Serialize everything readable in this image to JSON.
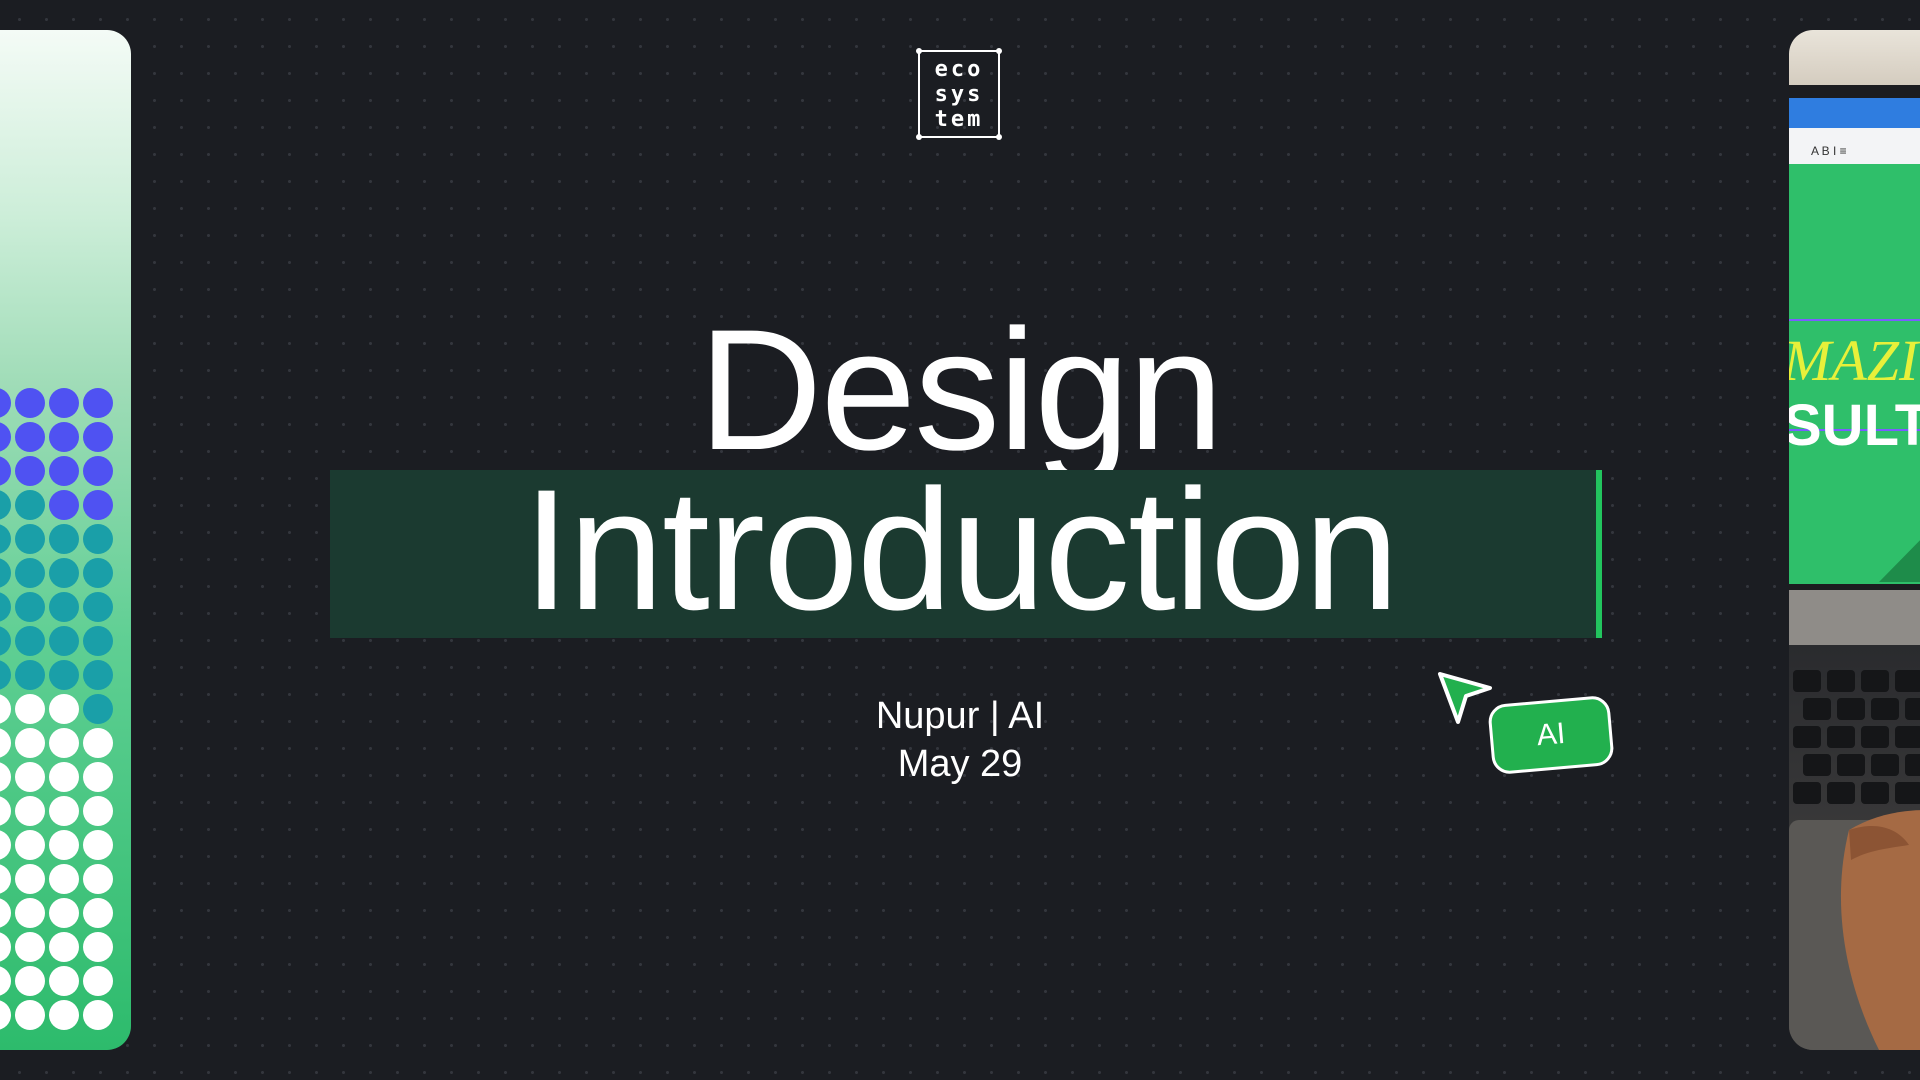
{
  "logo": {
    "line1": "eco",
    "line2": "sys",
    "line3": "tem"
  },
  "title": {
    "line1": "Design",
    "line2": "Introduction"
  },
  "subtitle": {
    "presenter": "Nupur | AI",
    "date": "May 29"
  },
  "badge": {
    "label": "AI"
  },
  "screen_text": {
    "line1": "MAZI",
    "line2": "SULT"
  },
  "colors": {
    "background": "#1b1d22",
    "accent_green": "#22c55e",
    "highlight_bg": "#1b3a30",
    "badge_green": "#22b04e",
    "dot_blue": "#4f52f2",
    "dot_teal": "#1a9fa8"
  }
}
